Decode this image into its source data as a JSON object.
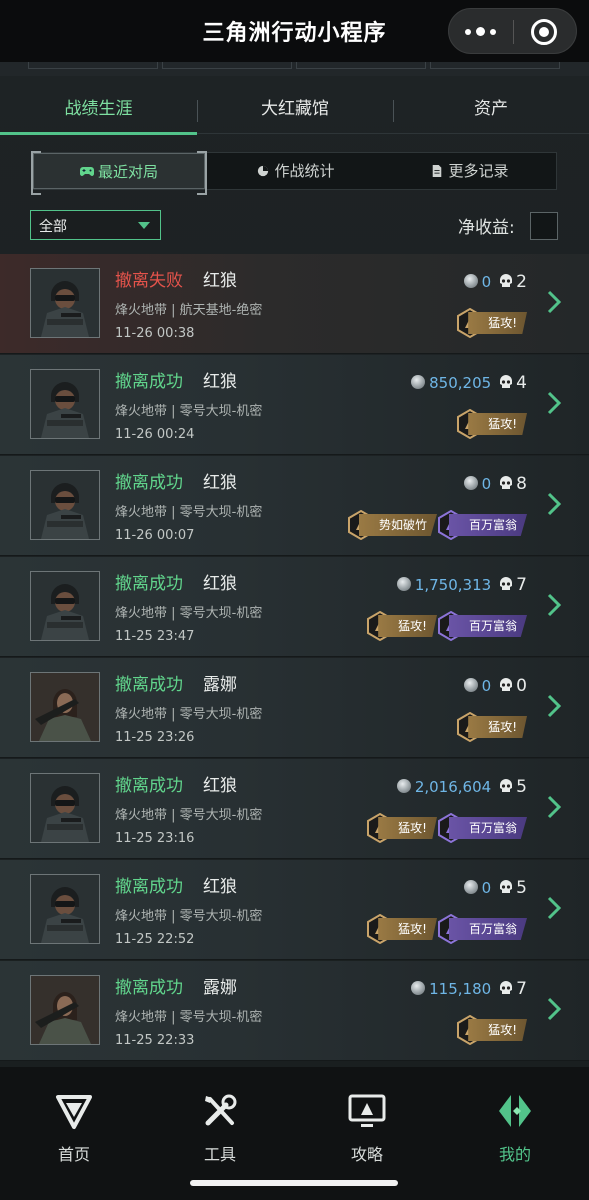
{
  "header": {
    "title": "三角洲行动小程序",
    "menu_icon": "more-dots-icon",
    "close_icon": "capsule-close-icon"
  },
  "tabs": [
    {
      "label": "战绩生涯",
      "active": true
    },
    {
      "label": "大红藏馆",
      "active": false
    },
    {
      "label": "资产",
      "active": false
    }
  ],
  "segments": [
    {
      "label": "最近对局",
      "icon": "gamepad-icon",
      "active": true
    },
    {
      "label": "作战统计",
      "icon": "pie-chart-icon",
      "active": false
    },
    {
      "label": "更多记录",
      "icon": "document-icon",
      "active": false
    }
  ],
  "filter": {
    "selected": "全部"
  },
  "net_income_label": "净收益:",
  "records": [
    {
      "status": "撤离失败",
      "status_type": "fail",
      "operator": "红狼",
      "map": "烽火地带 | 航天基地-绝密",
      "time": "11-26 00:38",
      "money": "0",
      "kills": "2",
      "badges": [
        {
          "label": "猛攻!",
          "type": "gold"
        }
      ]
    },
    {
      "status": "撤离成功",
      "status_type": "ok",
      "operator": "红狼",
      "map": "烽火地带 | 零号大坝-机密",
      "time": "11-26 00:24",
      "money": "850,205",
      "kills": "4",
      "badges": [
        {
          "label": "猛攻!",
          "type": "gold"
        }
      ]
    },
    {
      "status": "撤离成功",
      "status_type": "ok",
      "operator": "红狼",
      "map": "烽火地带 | 零号大坝-机密",
      "time": "11-26 00:07",
      "money": "0",
      "kills": "8",
      "badges": [
        {
          "label": "势如破竹",
          "type": "gold"
        },
        {
          "label": "百万富翁",
          "type": "purple"
        }
      ]
    },
    {
      "status": "撤离成功",
      "status_type": "ok",
      "operator": "红狼",
      "map": "烽火地带 | 零号大坝-机密",
      "time": "11-25 23:47",
      "money": "1,750,313",
      "kills": "7",
      "badges": [
        {
          "label": "猛攻!",
          "type": "gold"
        },
        {
          "label": "百万富翁",
          "type": "purple"
        }
      ]
    },
    {
      "status": "撤离成功",
      "status_type": "ok",
      "operator": "露娜",
      "map": "烽火地带 | 零号大坝-机密",
      "time": "11-25 23:26",
      "money": "0",
      "kills": "0",
      "badges": [
        {
          "label": "猛攻!",
          "type": "gold"
        }
      ]
    },
    {
      "status": "撤离成功",
      "status_type": "ok",
      "operator": "红狼",
      "map": "烽火地带 | 零号大坝-机密",
      "time": "11-25 23:16",
      "money": "2,016,604",
      "kills": "5",
      "badges": [
        {
          "label": "猛攻!",
          "type": "gold"
        },
        {
          "label": "百万富翁",
          "type": "purple"
        }
      ]
    },
    {
      "status": "撤离成功",
      "status_type": "ok",
      "operator": "红狼",
      "map": "烽火地带 | 零号大坝-机密",
      "time": "11-25 22:52",
      "money": "0",
      "kills": "5",
      "badges": [
        {
          "label": "猛攻!",
          "type": "gold"
        },
        {
          "label": "百万富翁",
          "type": "purple"
        }
      ]
    },
    {
      "status": "撤离成功",
      "status_type": "ok",
      "operator": "露娜",
      "map": "烽火地带 | 零号大坝-机密",
      "time": "11-25 22:33",
      "money": "115,180",
      "kills": "7",
      "badges": [
        {
          "label": "猛攻!",
          "type": "gold"
        }
      ]
    }
  ],
  "nav": [
    {
      "label": "首页",
      "icon": "delta-logo-icon",
      "active": false
    },
    {
      "label": "工具",
      "icon": "tools-icon",
      "active": false
    },
    {
      "label": "攻略",
      "icon": "monitor-guide-icon",
      "active": false
    },
    {
      "label": "我的",
      "icon": "profile-diamond-icon",
      "active": true
    }
  ],
  "colors": {
    "accent": "#52c38a",
    "fail": "#e4534b",
    "money": "#6fb6e6"
  }
}
